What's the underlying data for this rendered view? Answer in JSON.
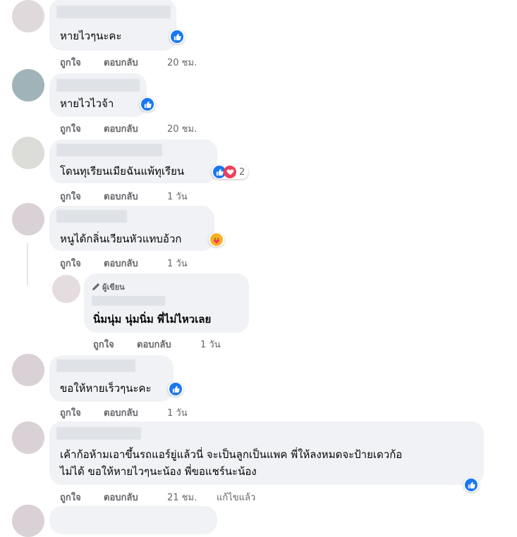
{
  "comments": [
    {
      "text": "หายไวๆนะคะ",
      "like": "ถูกใจ",
      "reply": "ตอบกลับ",
      "time": "20 ชม."
    },
    {
      "text": "หายไวไวจ้า",
      "like": "ถูกใจ",
      "reply": "ตอบกลับ",
      "time": "20 ชม."
    },
    {
      "text": "โดนทุเรียนเมียฉันแพ้ทุเรียน",
      "like": "ถูกใจ",
      "reply": "ตอบกลับ",
      "time": "1 วัน",
      "reaction_count": "2"
    },
    {
      "text": "หนูได้กลิ่นเวียนหัวแทบอ้วก",
      "like": "ถูกใจ",
      "reply": "ตอบกลับ",
      "time": "1 วัน"
    },
    {
      "badge": "ผู้เขียน",
      "text": "นิ่มนุ่ม นุ่มนิ่ม พี่ไม่ไหวเลย",
      "like": "ถูกใจ",
      "reply": "ตอบกลับ",
      "time": "1 วัน"
    },
    {
      "text": "ขอให้หายเร็วๆนะคะ",
      "like": "ถูกใจ",
      "reply": "ตอบกลับ",
      "time": "1 วัน"
    },
    {
      "text_line1": "เค้าก้อห้ามเอาขึ้นรถแอร์ยู่แล้วนี่ จะเป็นลูกเป็นแพค พี่ให้ลงหมดจะป้ายเดวก้อ",
      "text_line2": "ไม่ได้ ขอให้หายไวๆนะน้อง พี่ขอแชร์นะน้อง",
      "like": "ถูกใจ",
      "reply": "ตอบกลับ",
      "time": "21 ชม.",
      "edited": "แก้ไขแล้ว"
    }
  ],
  "colors": {
    "bubble": "#f0f2f5",
    "like": "#1877f2",
    "love": "#f33e58",
    "meta": "#65676b"
  },
  "icons": {
    "like": "like-icon",
    "love": "love-icon",
    "care": "care-icon",
    "pen": "pen-icon"
  }
}
